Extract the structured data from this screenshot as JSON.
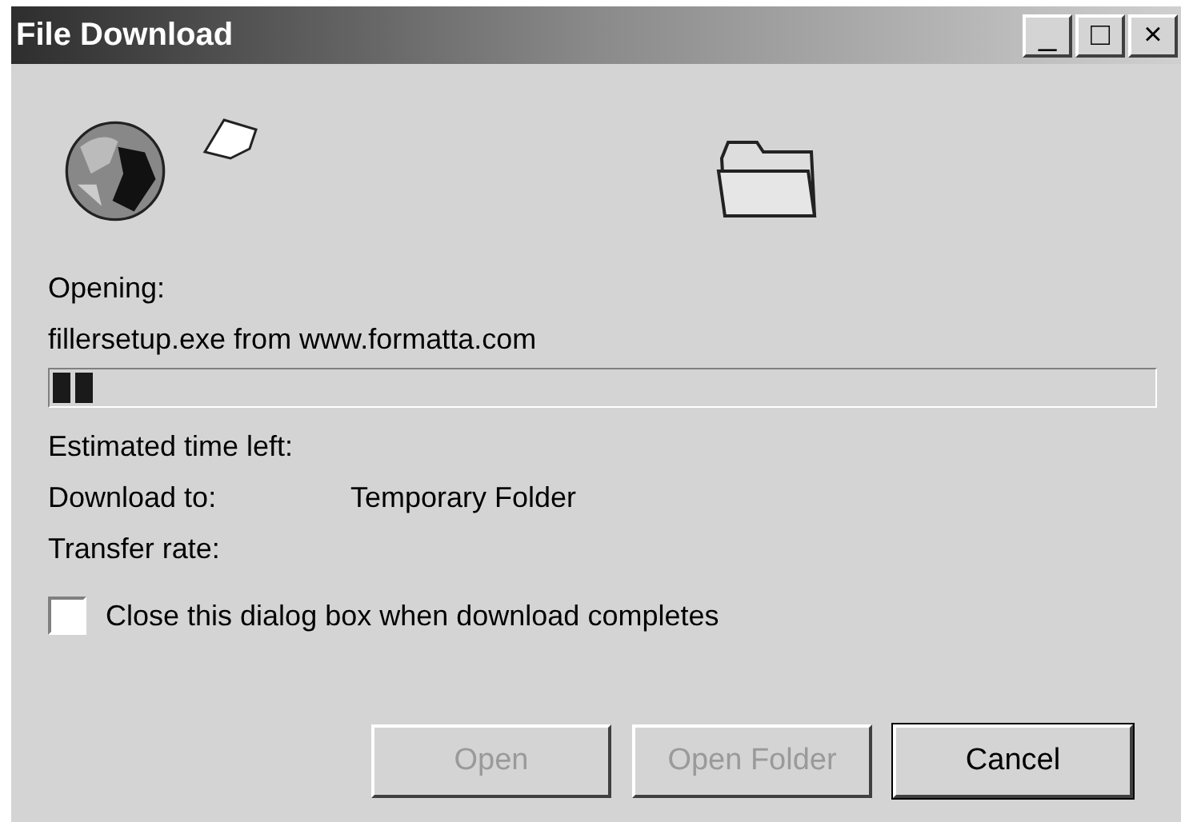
{
  "window": {
    "title": "File Download",
    "controls": [
      "_",
      "□",
      "×"
    ]
  },
  "status": {
    "label": "Opening:",
    "file": "fillersetup.exe from www.formatta.com"
  },
  "progress": {
    "level": 0.04
  },
  "details": [
    {
      "label": "Estimated time left:"
    },
    {
      "label": "Download to:",
      "value": "Temporary Folder"
    },
    {
      "label": "Transfer rate:"
    }
  ],
  "close_when_done": {
    "label": "Close this dialog box when download completes",
    "checked": false
  },
  "buttons": [
    {
      "label": "Open",
      "disabled": true
    },
    {
      "label": "Open Folder",
      "disabled": true
    },
    {
      "label": "Cancel",
      "disabled": false
    }
  ]
}
